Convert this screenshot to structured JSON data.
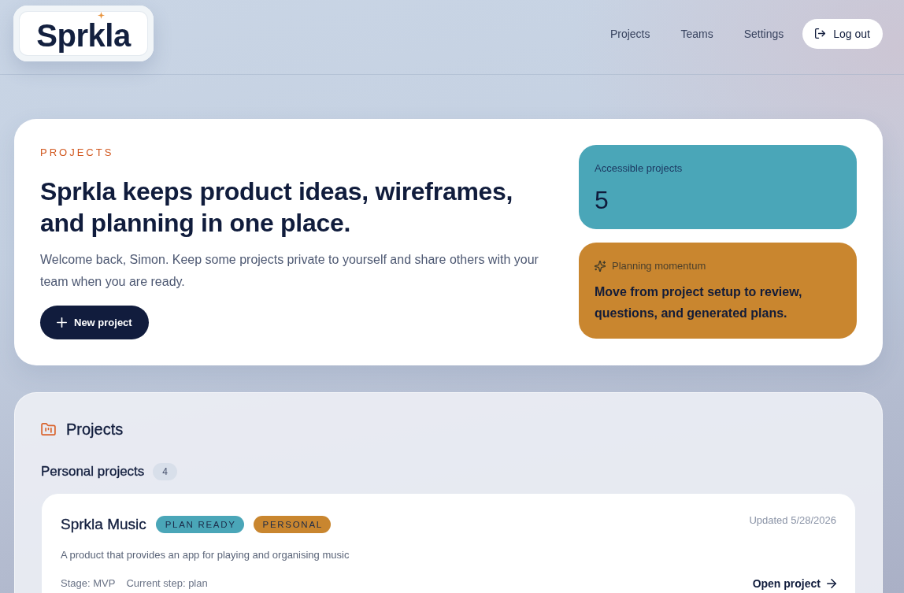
{
  "header": {
    "logo": "Sprkla",
    "nav": [
      {
        "label": "Projects"
      },
      {
        "label": "Teams"
      },
      {
        "label": "Settings"
      }
    ],
    "logout_button": "Log out"
  },
  "hero": {
    "eyebrow": "PROJECTS",
    "title": "Sprkla keeps product ideas, wireframes, and planning in one place.",
    "text": "Welcome back, Simon. Keep some projects private to yourself and share others with your team when you are ready.",
    "button": "New project",
    "stats": [
      {
        "kind": "count",
        "label": "Accessible projects",
        "value": "5",
        "color": "#4aa6b8"
      },
      {
        "kind": "note",
        "label": "Planning momentum",
        "text": "Move from project setup to review, questions, and generated plans.",
        "color": "#c9862f"
      }
    ]
  },
  "projects_panel": {
    "title": "Projects",
    "groups": [
      {
        "title": "Personal projects",
        "count": "4",
        "projects": [
          {
            "name": "Sprkla Music",
            "tags": [
              {
                "label": "PLAN READY",
                "color": "#4aa6b8"
              },
              {
                "label": "PERSONAL",
                "color": "#c9862f"
              }
            ],
            "updated": "Updated 5/28/2026",
            "description": "A product that provides an app for playing and organising music",
            "stage": "Stage: MVP",
            "step": "Current step: plan",
            "link": "Open project"
          }
        ]
      }
    ]
  }
}
